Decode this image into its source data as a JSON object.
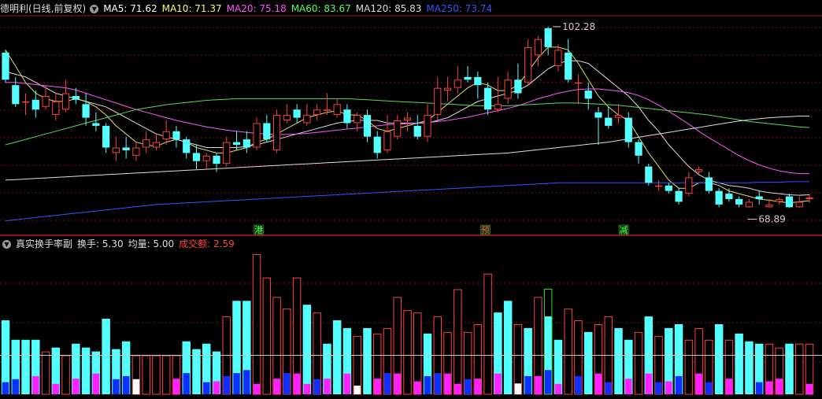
{
  "main_legend": {
    "title": "德明利(日线,前复权)",
    "items": [
      {
        "label": "MA5: 71.62",
        "color": "#ffffff"
      },
      {
        "label": "MA10: 71.37",
        "color": "#ffff66"
      },
      {
        "label": "MA20: 75.18",
        "color": "#ff55ff"
      },
      {
        "label": "MA60: 83.67",
        "color": "#55ff55"
      },
      {
        "label": "MA120: 85.83",
        "color": "#dddddd"
      },
      {
        "label": "MA250: 73.74",
        "color": "#3355ff"
      }
    ]
  },
  "sub_legend": {
    "title": "真实换手率副",
    "items": [
      {
        "label": "换手: 5.30",
        "color": "#dddddd"
      },
      {
        "label": "均量: 5.00",
        "color": "#dddddd"
      },
      {
        "label": "成交额: 2.59",
        "color": "#ff4444"
      }
    ]
  },
  "annotations": {
    "high_label": "102.28",
    "low_label": "68.89",
    "markers": [
      {
        "text": "港",
        "pos": 0.315
      },
      {
        "text": "预",
        "pos": 0.597
      },
      {
        "text": "减",
        "pos": 0.769
      }
    ]
  },
  "colors": {
    "up": "#ff4040",
    "down": "#54ffff",
    "grid": "#7a1010",
    "border": "#a01818",
    "volume_avg": "#cccccc",
    "volume_blue": "#1030ff",
    "volume_magenta": "#ff20ff"
  },
  "chart_data": {
    "type": "candlestick",
    "price_range": [
      66,
      104
    ],
    "candles": [
      [
        97.5,
        92.5,
        98.0,
        92.0
      ],
      [
        91.5,
        88.0,
        93.0,
        87.5
      ],
      [
        88.3,
        88.5,
        90.0,
        86.0
      ],
      [
        88.8,
        87.0,
        90.5,
        85.5
      ],
      [
        87.5,
        89.5,
        91.5,
        87.0
      ],
      [
        86.0,
        88.5,
        90.0,
        85.0
      ],
      [
        87.0,
        90.0,
        92.5,
        86.5
      ],
      [
        89.5,
        88.8,
        91.0,
        88.0
      ],
      [
        88.0,
        85.5,
        90.0,
        84.0
      ],
      [
        84.5,
        84.0,
        86.5,
        83.0
      ],
      [
        84.0,
        80.0,
        84.5,
        79.0
      ],
      [
        79.0,
        80.0,
        82.0,
        77.5
      ],
      [
        80.0,
        79.5,
        82.0,
        78.0
      ],
      [
        78.5,
        80.0,
        81.0,
        77.5
      ],
      [
        80.0,
        81.5,
        83.0,
        79.0
      ],
      [
        80.0,
        81.0,
        82.5,
        79.5
      ],
      [
        81.5,
        83.0,
        85.0,
        80.5
      ],
      [
        83.0,
        81.5,
        84.0,
        80.0
      ],
      [
        81.5,
        79.0,
        82.0,
        78.0
      ],
      [
        79.0,
        77.5,
        80.5,
        76.0
      ],
      [
        77.5,
        78.5,
        79.0,
        76.0
      ],
      [
        78.5,
        77.0,
        79.0,
        75.5
      ],
      [
        77.0,
        81.0,
        82.0,
        76.5
      ],
      [
        81.0,
        80.5,
        83.0,
        79.5
      ],
      [
        81.5,
        80.0,
        83.0,
        79.0
      ],
      [
        80.0,
        84.5,
        85.5,
        79.5
      ],
      [
        84.5,
        81.5,
        86.0,
        81.0
      ],
      [
        79.5,
        86.0,
        87.0,
        79.0
      ],
      [
        85.0,
        86.0,
        88.0,
        84.5
      ],
      [
        87.0,
        85.5,
        88.0,
        84.5
      ],
      [
        84.5,
        86.0,
        88.0,
        84.0
      ],
      [
        86.0,
        87.0,
        88.0,
        85.0
      ],
      [
        87.0,
        87.0,
        90.0,
        86.0
      ],
      [
        86.0,
        88.0,
        89.0,
        85.5
      ],
      [
        87.0,
        84.5,
        88.0,
        83.5
      ],
      [
        84.5,
        86.0,
        86.5,
        83.0
      ],
      [
        86.0,
        82.0,
        87.0,
        81.0
      ],
      [
        82.0,
        79.0,
        83.0,
        78.0
      ],
      [
        79.5,
        83.0,
        86.0,
        79.0
      ],
      [
        82.0,
        85.0,
        86.0,
        81.5
      ],
      [
        85.0,
        85.5,
        86.5,
        83.0
      ],
      [
        84.0,
        82.0,
        86.0,
        81.5
      ],
      [
        82.0,
        86.0,
        88.0,
        81.0
      ],
      [
        86.0,
        91.0,
        93.0,
        85.0
      ],
      [
        90.5,
        91.0,
        93.0,
        88.5
      ],
      [
        91.0,
        92.5,
        95.0,
        90.0
      ],
      [
        93.0,
        92.5,
        95.0,
        92.0
      ],
      [
        93.0,
        91.5,
        94.0,
        89.0
      ],
      [
        91.0,
        87.0,
        92.0,
        86.0
      ],
      [
        87.0,
        88.0,
        93.0,
        86.5
      ],
      [
        89.0,
        92.5,
        94.0,
        88.0
      ],
      [
        92.5,
        90.0,
        95.5,
        89.0
      ],
      [
        92.0,
        98.5,
        100.0,
        91.5
      ],
      [
        97.0,
        100.0,
        100.5,
        95.0
      ],
      [
        102.0,
        98.5,
        102.3,
        97.0
      ],
      [
        95.0,
        98.0,
        99.0,
        94.0
      ],
      [
        97.5,
        92.5,
        100.0,
        92.0
      ],
      [
        92.0,
        92.0,
        93.5,
        88.0
      ],
      [
        90.5,
        89.0,
        92.0,
        87.0
      ],
      [
        86.5,
        85.5,
        87.5,
        80.5
      ],
      [
        85.5,
        84.0,
        87.5,
        83.5
      ],
      [
        85.5,
        86.0,
        88.0,
        84.5
      ],
      [
        85.5,
        81.0,
        86.5,
        80.0
      ],
      [
        81.0,
        78.5,
        81.5,
        77.0
      ],
      [
        76.5,
        73.5,
        77.0,
        73.0
      ],
      [
        73.0,
        73.0,
        74.0,
        72.0
      ],
      [
        73.0,
        72.0,
        73.5,
        71.5
      ],
      [
        72.0,
        70.0,
        72.5,
        69.5
      ],
      [
        71.5,
        74.5,
        75.5,
        71.0
      ],
      [
        75.5,
        76.0,
        76.5,
        75.0
      ],
      [
        74.5,
        72.0,
        75.5,
        71.5
      ],
      [
        72.0,
        69.5,
        72.5,
        69.0
      ],
      [
        71.5,
        70.5,
        72.5,
        70.0
      ],
      [
        70.5,
        69.5,
        71.0,
        69.0
      ],
      [
        69.0,
        70.0,
        70.5,
        68.9
      ],
      [
        71.0,
        70.5,
        72.0,
        69.5
      ],
      [
        69.0,
        69.5,
        70.5,
        68.9
      ],
      [
        70.0,
        70.5,
        70.8,
        69.5
      ],
      [
        71.0,
        69.0,
        71.5,
        68.9
      ],
      [
        69.0,
        70.0,
        71.0,
        68.9
      ],
      [
        70.5,
        70.8,
        71.5,
        69.8
      ]
    ],
    "volumes": [
      [
        9.5,
        "d",
        "b"
      ],
      [
        7.0,
        "d",
        "b"
      ],
      [
        7.0,
        "d",
        "n"
      ],
      [
        7.0,
        "d",
        "m"
      ],
      [
        5.5,
        "u",
        "n"
      ],
      [
        6.0,
        "d",
        "m"
      ],
      [
        5.0,
        "u",
        "n"
      ],
      [
        6.5,
        "d",
        "m"
      ],
      [
        6.0,
        "d",
        "n"
      ],
      [
        5.5,
        "d",
        "m"
      ],
      [
        9.7,
        "d",
        "n"
      ],
      [
        5.8,
        "d",
        "b"
      ],
      [
        6.8,
        "d",
        "b"
      ],
      [
        5.0,
        "u",
        "w"
      ],
      [
        5.0,
        "u",
        "n"
      ],
      [
        5.0,
        "u",
        "n"
      ],
      [
        5.0,
        "u",
        "n"
      ],
      [
        5.0,
        "u",
        "m"
      ],
      [
        6.8,
        "d",
        "b"
      ],
      [
        5.8,
        "d",
        "n"
      ],
      [
        6.5,
        "d",
        "b"
      ],
      [
        5.5,
        "d",
        "m"
      ],
      [
        10.0,
        "u",
        "b"
      ],
      [
        12.0,
        "d",
        "b"
      ],
      [
        12.0,
        "d",
        "b"
      ],
      [
        18.0,
        "u",
        "m"
      ],
      [
        15.0,
        "u",
        "n"
      ],
      [
        12.5,
        "u",
        "m"
      ],
      [
        11.0,
        "u",
        "b"
      ],
      [
        15.0,
        "u",
        "m"
      ],
      [
        11.5,
        "d",
        "m"
      ],
      [
        10.5,
        "u",
        "b"
      ],
      [
        6.5,
        "d",
        "m"
      ],
      [
        9.5,
        "d",
        "n"
      ],
      [
        8.5,
        "d",
        "m"
      ],
      [
        7.5,
        "u",
        "w"
      ],
      [
        8.5,
        "d",
        "n"
      ],
      [
        7.8,
        "u",
        "m"
      ],
      [
        8.5,
        "u",
        "b"
      ],
      [
        12.5,
        "u",
        "m"
      ],
      [
        10.8,
        "u",
        "n"
      ],
      [
        10.5,
        "u",
        "m"
      ],
      [
        7.8,
        "d",
        "b"
      ],
      [
        10.0,
        "u",
        "b"
      ],
      [
        8.0,
        "u",
        "m"
      ],
      [
        13.5,
        "u",
        "m"
      ],
      [
        8.0,
        "u",
        "b"
      ],
      [
        9.0,
        "u",
        "m"
      ],
      [
        15.5,
        "u",
        "n"
      ],
      [
        10.5,
        "d",
        "m"
      ],
      [
        12.0,
        "d",
        "n"
      ],
      [
        9.0,
        "u",
        "w"
      ],
      [
        8.5,
        "d",
        "b"
      ],
      [
        12.5,
        "u",
        "m"
      ],
      [
        10.0,
        "d",
        "b"
      ],
      [
        7.0,
        "d",
        "m"
      ],
      [
        11.0,
        "u",
        "n"
      ],
      [
        9.5,
        "u",
        "b"
      ],
      [
        8.0,
        "d",
        "n"
      ],
      [
        9.0,
        "u",
        "m"
      ],
      [
        10.0,
        "u",
        "b"
      ],
      [
        8.5,
        "d",
        "n"
      ],
      [
        7.0,
        "d",
        "m"
      ],
      [
        8.0,
        "u",
        "n"
      ],
      [
        10.0,
        "d",
        "m"
      ],
      [
        7.5,
        "u",
        "b"
      ],
      [
        8.5,
        "d",
        "m"
      ],
      [
        9.0,
        "d",
        "b"
      ],
      [
        7.0,
        "u",
        "n"
      ],
      [
        8.5,
        "u",
        "m"
      ],
      [
        7.0,
        "u",
        "b"
      ],
      [
        9.0,
        "d",
        "n"
      ],
      [
        7.0,
        "u",
        "m"
      ],
      [
        7.8,
        "d",
        "n"
      ],
      [
        6.8,
        "d",
        "n"
      ],
      [
        6.5,
        "d",
        "b"
      ],
      [
        6.5,
        "u",
        "m"
      ],
      [
        6.0,
        "u",
        "m"
      ],
      [
        6.5,
        "d",
        "n"
      ],
      [
        6.5,
        "u",
        "n"
      ],
      [
        6.5,
        "u",
        "m"
      ]
    ],
    "ma_series": [
      {
        "name": "MA5",
        "color": "#dddd66",
        "values": [
          98,
          95,
          92,
          90,
          89,
          88.5,
          88.5,
          89,
          88.5,
          87.5,
          86,
          84,
          82.5,
          81,
          80.5,
          80.2,
          81,
          81.5,
          81,
          80,
          79.5,
          79,
          79,
          79.5,
          80,
          81,
          81.5,
          82.5,
          83.5,
          84.5,
          85.5,
          86,
          86.5,
          86.8,
          86,
          86,
          85,
          83.5,
          83,
          83.5,
          84,
          84.5,
          85,
          86.5,
          88,
          89.5,
          91,
          92,
          91.5,
          90.5,
          90.5,
          91.5,
          94,
          96.5,
          98.5,
          98.5,
          98,
          95.5,
          92.5,
          89.5,
          87.5,
          86,
          85,
          82,
          79,
          76.5,
          74,
          72.5,
          72.5,
          73.5,
          73.5,
          73,
          72,
          71.5,
          71,
          70.5,
          70.3,
          70,
          69.8,
          70,
          70.2
        ]
      },
      {
        "name": "MA10",
        "color": "#dddddd",
        "values": [
          94,
          93.5,
          93,
          92,
          91,
          90,
          89.5,
          89,
          88.5,
          88,
          87.5,
          86.5,
          85.5,
          84.5,
          83.5,
          82.5,
          82,
          81.5,
          81,
          80.5,
          80,
          80,
          80,
          80,
          80.2,
          80.5,
          81,
          81.5,
          82,
          82.5,
          83,
          83.5,
          84,
          84.5,
          84.8,
          85,
          85,
          85,
          84.5,
          84.5,
          84.5,
          84.5,
          84.5,
          85,
          85.5,
          86.5,
          87.5,
          88.5,
          89,
          89.5,
          90,
          90.5,
          91.5,
          93,
          94.5,
          95.5,
          96,
          96,
          95.5,
          94,
          92.5,
          91,
          89.5,
          87.5,
          85,
          83,
          80.5,
          78.5,
          76.5,
          75,
          74,
          73.5,
          73,
          72.8,
          72.5,
          72,
          71.7,
          71.5,
          71.3,
          71.2,
          71.3
        ]
      },
      {
        "name": "MA20",
        "color": "#ff55ff",
        "values": [
          92,
          92,
          91.8,
          91.6,
          91.4,
          91.2,
          91,
          90.6,
          90,
          89.4,
          88.8,
          88.2,
          87.6,
          87,
          86.5,
          86,
          85.5,
          85,
          84.6,
          84.2,
          83.8,
          83.5,
          83.2,
          83,
          82.8,
          82.6,
          82.5,
          82.4,
          82.4,
          82.5,
          82.6,
          82.8,
          83,
          83.2,
          83.4,
          83.6,
          83.8,
          84,
          84.2,
          84.3,
          84.4,
          84.5,
          84.6,
          84.8,
          85,
          85.3,
          85.6,
          86,
          86.4,
          86.8,
          87.2,
          87.7,
          88.3,
          89,
          89.5,
          90,
          90.4,
          90.7,
          90.8,
          90.8,
          90.6,
          90.4,
          90.1,
          89.6,
          88.8,
          87.8,
          86.7,
          85.5,
          84.3,
          83,
          81.8,
          80.7,
          79.6,
          78.5,
          77.6,
          76.8,
          76.2,
          75.7,
          75.4,
          75.2,
          75.2
        ]
      },
      {
        "name": "MA60",
        "color": "#55dd55",
        "values": [
          80.5,
          81,
          81.5,
          82,
          82.5,
          83,
          83.5,
          84,
          84.5,
          85,
          85.5,
          86,
          86.5,
          87,
          87.3,
          87.6,
          87.9,
          88.1,
          88.3,
          88.5,
          88.7,
          88.8,
          88.9,
          89,
          89,
          89,
          89,
          89,
          89,
          89,
          89,
          89,
          89,
          89,
          89,
          88.9,
          88.8,
          88.7,
          88.6,
          88.5,
          88.4,
          88.3,
          88.2,
          88.1,
          88,
          87.9,
          87.8,
          87.7,
          87.7,
          87.7,
          87.7,
          87.8,
          87.9,
          88,
          88.1,
          88.2,
          88.2,
          88.2,
          88.1,
          88,
          87.9,
          87.8,
          87.6,
          87.4,
          87.2,
          87,
          86.8,
          86.6,
          86.4,
          86.2,
          86,
          85.7,
          85.4,
          85.1,
          84.8,
          84.6,
          84.4,
          84.2,
          84,
          83.8,
          83.7
        ]
      },
      {
        "name": "MA120",
        "color": "#dddddd",
        "values": [
          74,
          74.1,
          74.2,
          74.3,
          74.4,
          74.5,
          74.6,
          74.7,
          74.8,
          74.9,
          75,
          75.1,
          75.2,
          75.3,
          75.4,
          75.5,
          75.6,
          75.7,
          75.8,
          75.9,
          76,
          76.1,
          76.2,
          76.3,
          76.4,
          76.5,
          76.6,
          76.7,
          76.8,
          76.9,
          77,
          77.1,
          77.2,
          77.3,
          77.4,
          77.5,
          77.6,
          77.7,
          77.8,
          77.9,
          78,
          78.1,
          78.2,
          78.3,
          78.4,
          78.5,
          78.6,
          78.7,
          78.8,
          78.9,
          79,
          79.2,
          79.4,
          79.6,
          79.8,
          80,
          80.2,
          80.4,
          80.6,
          80.8,
          81,
          81.3,
          81.6,
          81.9,
          82.2,
          82.5,
          82.8,
          83.1,
          83.4,
          83.7,
          84,
          84.3,
          84.6,
          84.9,
          85.1,
          85.3,
          85.5,
          85.6,
          85.7,
          85.8,
          85.8
        ]
      },
      {
        "name": "MA250",
        "color": "#3355ff",
        "values": [
          66.5,
          66.7,
          66.9,
          67.1,
          67.3,
          67.5,
          67.7,
          67.9,
          68.1,
          68.3,
          68.5,
          68.7,
          68.9,
          69.1,
          69.3,
          69.5,
          69.6,
          69.7,
          69.8,
          69.9,
          70,
          70.1,
          70.2,
          70.3,
          70.4,
          70.5,
          70.6,
          70.7,
          70.8,
          70.9,
          71,
          71.1,
          71.2,
          71.3,
          71.4,
          71.5,
          71.6,
          71.7,
          71.8,
          71.9,
          72,
          72.1,
          72.2,
          72.3,
          72.4,
          72.5,
          72.6,
          72.7,
          72.8,
          72.9,
          73,
          73.1,
          73.2,
          73.3,
          73.4,
          73.5,
          73.5,
          73.5,
          73.5,
          73.5,
          73.5,
          73.5,
          73.5,
          73.5,
          73.5,
          73.5,
          73.5,
          73.5,
          73.5,
          73.5,
          73.5,
          73.5,
          73.5,
          73.5,
          73.5,
          73.6,
          73.6,
          73.6,
          73.7,
          73.7,
          73.7
        ]
      }
    ]
  }
}
